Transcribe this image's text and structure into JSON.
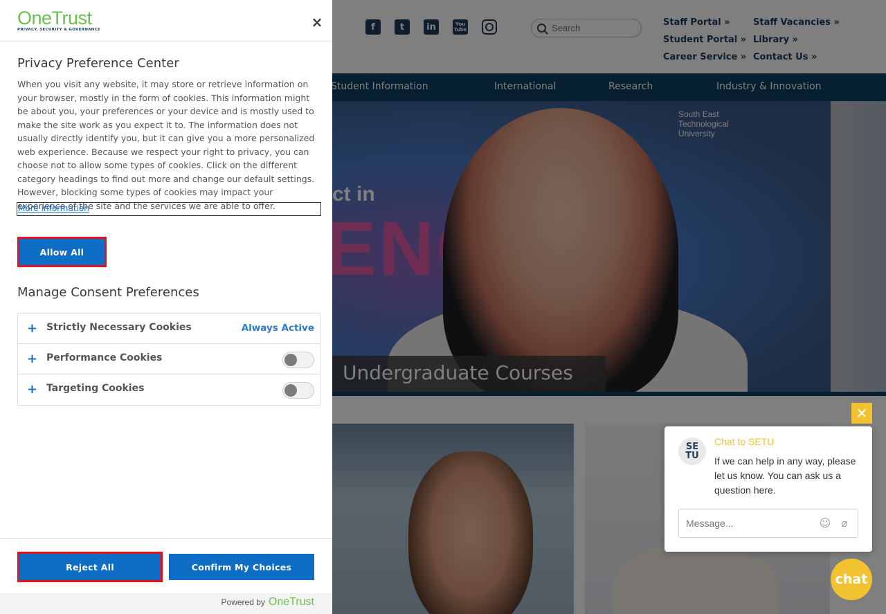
{
  "site": {
    "social": [
      "f",
      "t",
      "in",
      "You Tube",
      ""
    ],
    "search": {
      "placeholder": "Search"
    },
    "quick_links": [
      "Staff Portal »",
      "Staff Vacancies »",
      "Student Portal »",
      "Library »",
      "Career Service »",
      "Contact Us »"
    ],
    "nav": [
      "Student Information",
      "International",
      "Research",
      "Industry & Innovation"
    ],
    "hero": {
      "intro_text": "ct in",
      "word_text": "ENCE",
      "logo_text": "South East\nTechnological\nUniversity",
      "caption": "Undergraduate Courses"
    }
  },
  "chat": {
    "close": "✕",
    "avatar": "SE\nTU",
    "title": "Chat to SETU",
    "message": "If we can help in any way, please let us know. You can ask us a question here.",
    "input_placeholder": "Message...",
    "emoji_icon": "☺",
    "attach_icon": "⌀",
    "bubble": "chat"
  },
  "onetrust": {
    "logo": {
      "name": "OneTrust",
      "tagline": "PRIVACY, SECURITY & GOVERNANCE"
    },
    "close": "×",
    "title": "Privacy Preference Center",
    "description": "When you visit any website, it may store or retrieve information on your browser, mostly in the form of cookies. This information might be about you, your preferences or your device and is mostly used to make the site work as you expect it to. The information does not usually directly identify you, but it can give you a more personalized web experience. Because we respect your right to privacy, you can choose not to allow some types of cookies. Click on the different category headings to find out more and change our default settings. However, blocking some types of cookies may impact your experience of the site and the services we are able to offer.",
    "more_info": "More information",
    "allow_all": "Allow All",
    "manage_title": "Manage Consent Preferences",
    "categories": [
      {
        "label": "Strictly Necessary Cookies",
        "status": "Always Active"
      },
      {
        "label": "Performance Cookies",
        "enabled": false
      },
      {
        "label": "Targeting Cookies",
        "enabled": false
      }
    ],
    "expand_symbol": "+",
    "reject_all": "Reject All",
    "confirm": "Confirm My Choices",
    "powered_by": "Powered by",
    "powered_brand": "OneTrust",
    "colors": {
      "accent": "#0e6ec6",
      "brand_green": "#6cc04a",
      "highlight": "#e8101a"
    }
  }
}
